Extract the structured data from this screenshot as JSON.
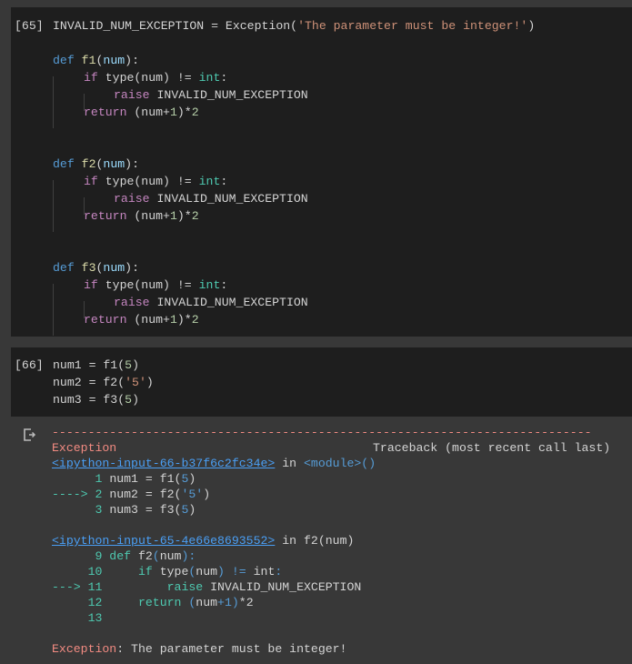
{
  "cells": [
    {
      "execution_count": "[65]",
      "lines": [
        "INVALID_NUM_EXCEPTION = Exception('The parameter must be integer!')",
        "",
        "def f1(num):",
        "    if type(num) != int:",
        "        raise INVALID_NUM_EXCEPTION",
        "    return (num+1)*2",
        "",
        "",
        "def f2(num):",
        "    if type(num) != int:",
        "        raise INVALID_NUM_EXCEPTION",
        "    return (num+1)*2",
        "",
        "",
        "def f3(num):",
        "    if type(num) != int:",
        "        raise INVALID_NUM_EXCEPTION",
        "    return (num+1)*2"
      ]
    },
    {
      "execution_count": "[66]",
      "lines": [
        "num1 = f1(5)",
        "num2 = f2('5')",
        "num3 = f3(5)"
      ]
    }
  ],
  "output": {
    "icon": "output-redirect-icon",
    "separator": "---------------------------------------------------------------------------",
    "exception_name": "Exception",
    "traceback_header": "Traceback (most recent call last)",
    "frames": [
      {
        "link": "<ipython-input-66-b37f6c2fc34e>",
        "location_in": "in",
        "location": "<module>()",
        "lines": [
          {
            "marker": "",
            "lineno": "1",
            "code": "num1 = f1(5)"
          },
          {
            "marker": "---->",
            "lineno": "2",
            "code": "num2 = f2('5')"
          },
          {
            "marker": "",
            "lineno": "3",
            "code": "num3 = f3(5)"
          }
        ]
      },
      {
        "link": "<ipython-input-65-4e66e8693552>",
        "location_in": "in",
        "location": "f2(num)",
        "lines": [
          {
            "marker": "",
            "lineno": "9",
            "code": "def f2(num):"
          },
          {
            "marker": "",
            "lineno": "10",
            "code": "    if type(num) != int:"
          },
          {
            "marker": "--->",
            "lineno": "11",
            "code": "        raise INVALID_NUM_EXCEPTION"
          },
          {
            "marker": "",
            "lineno": "12",
            "code": "    return (num+1)*2"
          },
          {
            "marker": "",
            "lineno": "13",
            "code": ""
          }
        ]
      }
    ],
    "final_error": {
      "name": "Exception",
      "message": ": The parameter must be integer!"
    }
  }
}
